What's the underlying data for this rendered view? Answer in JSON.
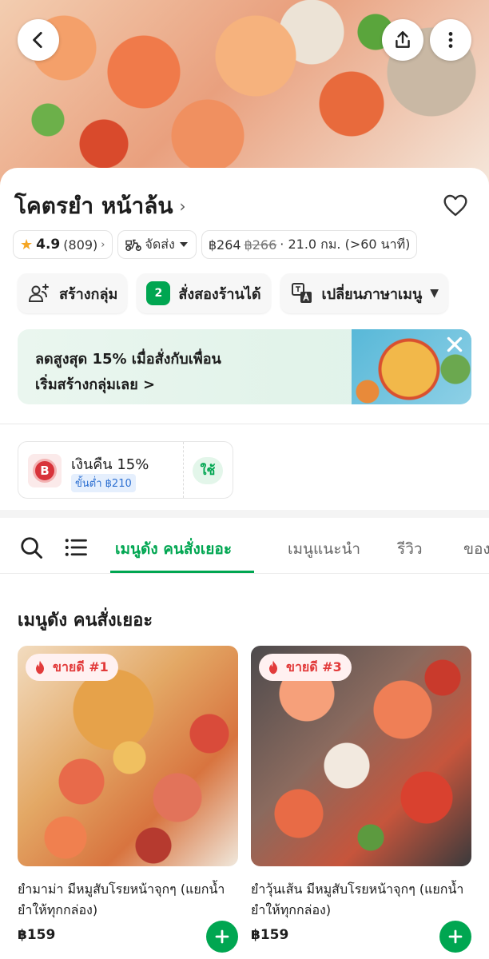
{
  "restaurant": {
    "name": "โคตรยำ หน้าล้น",
    "chevron": "›"
  },
  "info": {
    "rating": "4.9",
    "rating_count": "(809)",
    "rating_chevron": "›",
    "delivery_label": "จัดส่ง",
    "fee": "฿264",
    "fee_original": "฿266",
    "distance_eta": "· 21.0 กม. (>60 นาที)"
  },
  "actions": {
    "create_group": "สร้างกลุ่ม",
    "order_two_shops": "สั่งสองร้านได้",
    "order_two_shops_badge": "2",
    "translate_menu": "เปลี่ยนภาษาเมนู"
  },
  "promo": {
    "line1": "ลดสูงสุด 15% เมื่อสั่งกับเพื่อน",
    "line2": "เริ่มสร้างกลุ่มเลย >"
  },
  "cashback": {
    "coin_symbol": "B",
    "title": "เงินคืน 15%",
    "min": "ขั้นต่ำ ฿210",
    "use_label": "ใช้"
  },
  "tabs": [
    {
      "label": "เมนูดัง คนสั่งเยอะ",
      "active": true
    },
    {
      "label": "เมนูแนะนำ",
      "active": false
    },
    {
      "label": "รีวิว",
      "active": false
    },
    {
      "label": "ของ",
      "active": false
    }
  ],
  "section": {
    "title": "เมนูดัง คนสั่งเยอะ"
  },
  "items": [
    {
      "badge": "ขายดี #1",
      "name": "ยำมาม่า มีหมูสับโรยหน้าจุกๆ (แยกน้ำยำให้ทุกกล่อง)",
      "price": "฿159"
    },
    {
      "badge": "ขายดี #3",
      "name": "ยำวุ้นเส้น มีหมูสับโรยหน้าจุกๆ (แยกน้ำยำให้ทุกกล่อง)",
      "price": "฿159"
    }
  ],
  "colors": {
    "accent": "#00a651",
    "badge_text": "#e23b3b",
    "link_blue": "#2c6fd1"
  }
}
